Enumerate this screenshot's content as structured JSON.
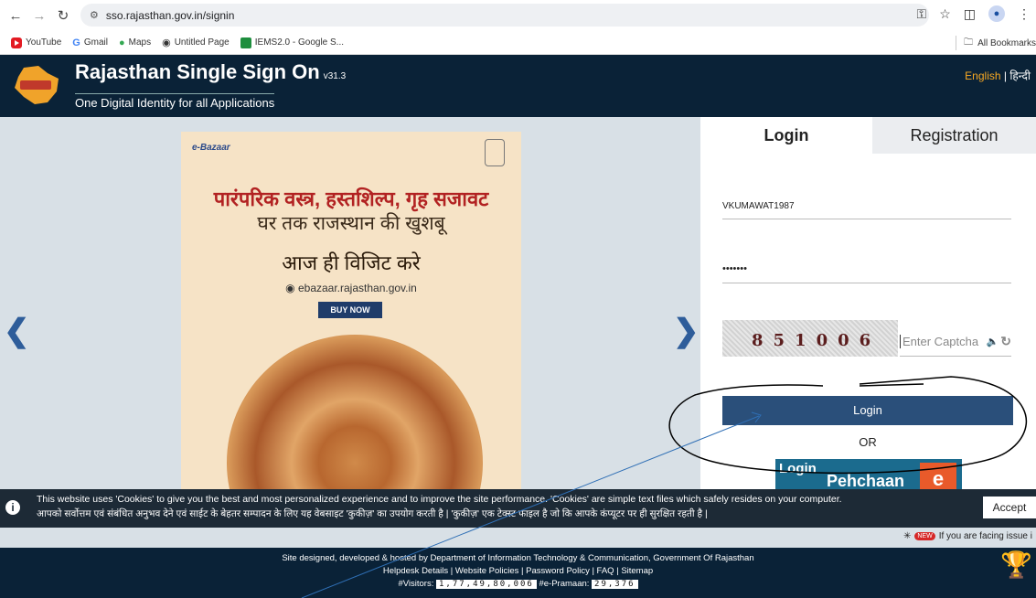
{
  "browser": {
    "url": "sso.rajasthan.gov.in/signin",
    "bookmarks": [
      "YouTube",
      "Gmail",
      "Maps",
      "Untitled Page",
      "IEMS2.0 - Google S..."
    ],
    "all_bookmarks": "All Bookmarks"
  },
  "header": {
    "title": "Rajasthan Single Sign On",
    "version": "v31.3",
    "tagline": "One Digital Identity for all Applications",
    "lang_english": "English",
    "lang_hindi": "हिन्दी"
  },
  "banner": {
    "brand": "e-Bazaar",
    "line1": "पारंपरिक वस्त्र, हस्तशिल्प, गृह सजावट",
    "line2": "घर तक राजस्थान की खुशबू",
    "line3": "आज ही विजिट करे",
    "site": "ebazaar.rajasthan.gov.in",
    "buy_now": "BUY NOW"
  },
  "login": {
    "tab_login": "Login",
    "tab_registration": "Registration",
    "username": "VKUMAWAT1987",
    "password": "•••••••",
    "captcha": "851006",
    "captcha_placeholder": "Enter Captcha",
    "login_button": "Login",
    "or": "OR",
    "pehchaan_t1": "Login",
    "pehchaan_t2": "Pehchaan"
  },
  "cookie": {
    "english": "This website uses 'Cookies' to give you the best and most personalized experience and to improve the site performance. 'Cookies' are simple text files which safely resides on your computer.",
    "hindi": "आपको सर्वोत्तम एवं संबंधित अनुभव देने एवं साईट के बेहतर सम्पादन के लिए यह वेबसाइट 'कुकीज़' का उपयोग करती है | 'कुकीज़' एक टेक्स्ट फाइल है जो कि आपके कंप्यूटर पर ही सुरक्षित रहती है |",
    "accept": "Accept"
  },
  "note": {
    "new": "NEW",
    "text": "If you are facing issue i"
  },
  "footer": {
    "line1": "Site designed, developed & hosted by Department of Information Technology & Communication, Government Of Rajasthan",
    "line2": "Helpdesk Details | Website Policies | Password Policy | FAQ | Sitemap",
    "visitors_label": "#Visitors:",
    "visitors": "1,77,49,80,006",
    "epramaan_label": "#e-Pramaan:",
    "epramaan": "29,376"
  }
}
